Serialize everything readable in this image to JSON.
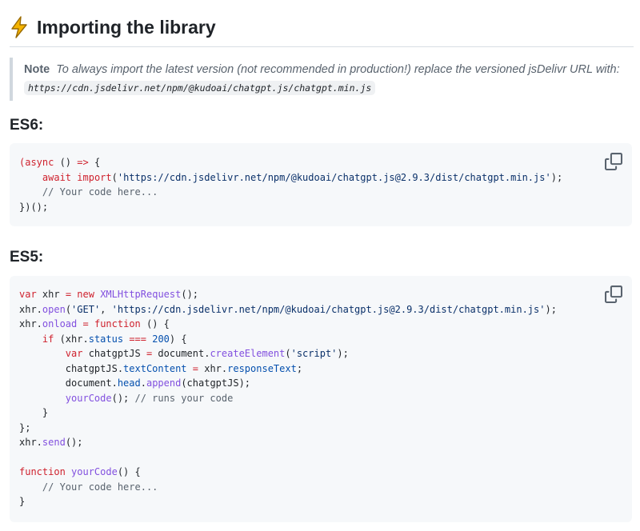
{
  "heading": {
    "title": "Importing the library"
  },
  "note": {
    "label": "Note",
    "text": "To always import the latest version (not recommended in production!) replace the versioned jsDelivr URL with:",
    "url": "https://cdn.jsdelivr.net/npm/@kudoai/chatgpt.js/chatgpt.min.js"
  },
  "es6": {
    "label": "ES6:",
    "code": [
      "(async () => {",
      "    await import('https://cdn.jsdelivr.net/npm/@kudoai/chatgpt.js@2.9.3/dist/chatgpt.min.js');",
      "    // Your code here...",
      "})();"
    ]
  },
  "es5": {
    "label": "ES5:",
    "code": [
      "var xhr = new XMLHttpRequest();",
      "xhr.open('GET', 'https://cdn.jsdelivr.net/npm/@kudoai/chatgpt.js@2.9.3/dist/chatgpt.min.js');",
      "xhr.onload = function () {",
      "    if (xhr.status === 200) {",
      "        var chatgptJS = document.createElement('script');",
      "        chatgptJS.textContent = xhr.responseText;",
      "        document.head.append(chatgptJS);",
      "        yourCode(); // runs your code",
      "    }",
      "};",
      "xhr.send();",
      "",
      "function yourCode() {",
      "    // Your code here...",
      "}"
    ]
  },
  "icons": {
    "heading": "lightning-bolt-icon",
    "copy": "copy-icon"
  },
  "colors": {
    "keyword": "#cf222e",
    "string": "#0a3069",
    "function": "#8250df",
    "comment": "#59636e",
    "constant": "#0550ae",
    "accent": "#f5b400"
  }
}
